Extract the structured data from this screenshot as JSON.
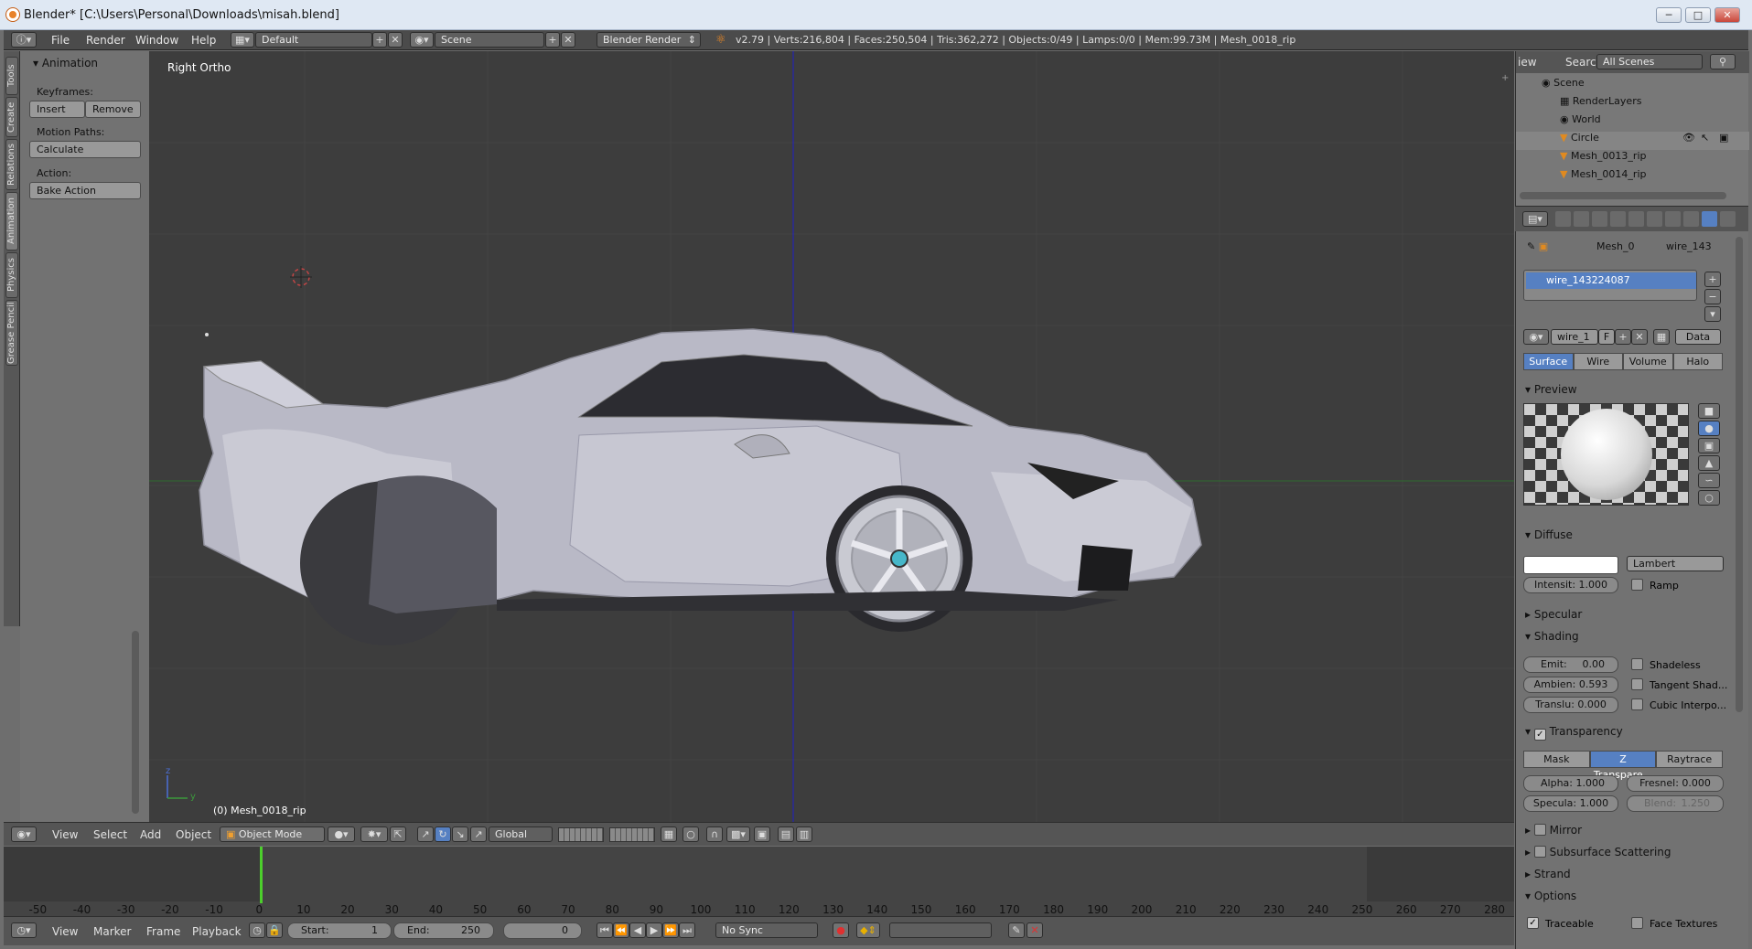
{
  "window": {
    "title": "Blender* [C:\\Users\\Personal\\Downloads\\misah.blend]",
    "minimize": "─",
    "maximize": "□",
    "close": "✕"
  },
  "infobar": {
    "menus": [
      "File",
      "Render",
      "Window",
      "Help"
    ],
    "layout": "Default",
    "scene": "Scene",
    "engine": "Blender Render",
    "stats": "v2.79 | Verts:216,804 | Faces:250,504 | Tris:362,272 | Objects:0/49 | Lamps:0/0 | Mem:99.73M | Mesh_0018_rip"
  },
  "toolstrip": {
    "tabs": [
      "Tools",
      "Create",
      "Relations",
      "Animation",
      "Physics",
      "Grease Pencil"
    ]
  },
  "toolshelf": {
    "panel_title": "Animation",
    "keyframes_label": "Keyframes:",
    "insert": "Insert",
    "remove": "Remove",
    "motion_paths_label": "Motion Paths:",
    "calculate": "Calculate",
    "action_label": "Action:",
    "bake_action": "Bake Action"
  },
  "viewport": {
    "view_name": "Right Ortho",
    "object_label": "(0) Mesh_0018_rip",
    "axis_z": "z",
    "axis_y": "y"
  },
  "viewport_header": {
    "menus": [
      "View",
      "Select",
      "Add",
      "Object"
    ],
    "mode": "Object Mode",
    "orientation": "Global"
  },
  "timeline": {
    "ticks": [
      "-50",
      "-40",
      "-30",
      "-20",
      "-10",
      "0",
      "10",
      "20",
      "30",
      "40",
      "50",
      "60",
      "70",
      "80",
      "90",
      "100",
      "110",
      "120",
      "130",
      "140",
      "150",
      "160",
      "170",
      "180",
      "190",
      "200",
      "210",
      "220",
      "230",
      "240",
      "250",
      "260",
      "270",
      "280"
    ],
    "current_frame": 0
  },
  "timeline_header": {
    "menus": [
      "View",
      "Marker",
      "Frame",
      "Playback"
    ],
    "start_label": "Start:",
    "start_value": "1",
    "end_label": "End:",
    "end_value": "250",
    "frame_value": "0",
    "sync": "No Sync"
  },
  "outliner": {
    "view_tab": "iew",
    "search": "Search",
    "scenes": "All Scenes",
    "items": [
      "Scene",
      "RenderLayers",
      "World",
      "Circle",
      "Mesh_0013_rip",
      "Mesh_0014_rip"
    ]
  },
  "properties": {
    "breadcrumb_mesh": "Mesh_0",
    "breadcrumb_material": "wire_143",
    "material_slot": "wire_143224087",
    "material_name": "wire_1",
    "fake_user": "F",
    "link": "Data",
    "tabs": [
      "Surface",
      "Wire",
      "Volume",
      "Halo"
    ],
    "active_tab": "Surface",
    "preview_title": "Preview",
    "diffuse_title": "Diffuse",
    "diffuse_shader": "Lambert",
    "intensity": "Intensit: 1.000",
    "ramp": "Ramp",
    "specular_title": "Specular",
    "shading_title": "Shading",
    "emit": "Emit:",
    "emit_value": "0.00",
    "ambient": "Ambien: 0.593",
    "translucency": "Translu: 0.000",
    "shadeless": "Shadeless",
    "tangent": "Tangent Shad...",
    "cubic": "Cubic Interpo...",
    "transparency_title": "Transparency",
    "transp_modes": [
      "Mask",
      "Z Transpare...",
      "Raytrace"
    ],
    "transp_active": "Z Transpare...",
    "alpha": "Alpha:",
    "alpha_value": "1.000",
    "fresnel": "Fresnel: 0.000",
    "specular_val": "Specula: 1.000",
    "blend": "Blend:",
    "blend_value": "1.250",
    "mirror_title": "Mirror",
    "sss_title": "Subsurface Scattering",
    "strand_title": "Strand",
    "options_title": "Options",
    "traceable": "Traceable",
    "face_textures": "Face Textures"
  },
  "colors": {
    "viewport_bg": "#3d3d3d",
    "panel_bg": "#727272",
    "selection": "#5680c2",
    "playhead": "#4ccf2c"
  }
}
